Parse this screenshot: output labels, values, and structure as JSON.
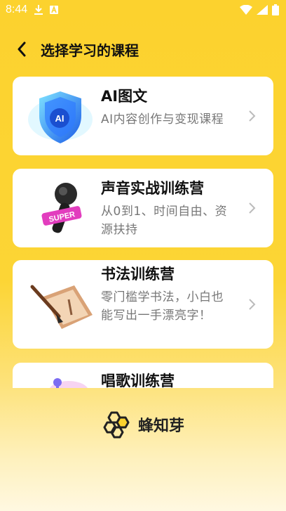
{
  "status_bar": {
    "time": "8:44",
    "left_icons": [
      "download-icon",
      "notification-a-icon"
    ],
    "right_icons": [
      "wifi-icon",
      "signal-icon",
      "battery-icon"
    ]
  },
  "header": {
    "title": "选择学习的课程",
    "back_icon": "chevron-left-icon"
  },
  "courses": [
    {
      "title": "AI图文",
      "description": "AI内容创作与变现课程",
      "thumb_icon": "ai-shield-icon"
    },
    {
      "title": "声音实战训练营",
      "description": "从0到1、时间自由、资源扶持",
      "thumb_icon": "microphone-icon",
      "thumb_badge": "SUPER"
    },
    {
      "title": "书法训练营",
      "description": "零门槛学书法，小白也能写出一手漂亮字！",
      "thumb_icon": "calligraphy-brush-icon"
    },
    {
      "title": "唱歌训练营",
      "description": "",
      "thumb_icon": "singing-icon"
    }
  ],
  "brand": {
    "name": "蜂知芽",
    "logo_icon": "honeycomb-logo-icon"
  },
  "colors": {
    "background_top": "#FCD22E",
    "background_bottom": "#FFF8E1",
    "card": "#FFFFFF",
    "title_text": "#111111",
    "desc_text": "#777777"
  }
}
